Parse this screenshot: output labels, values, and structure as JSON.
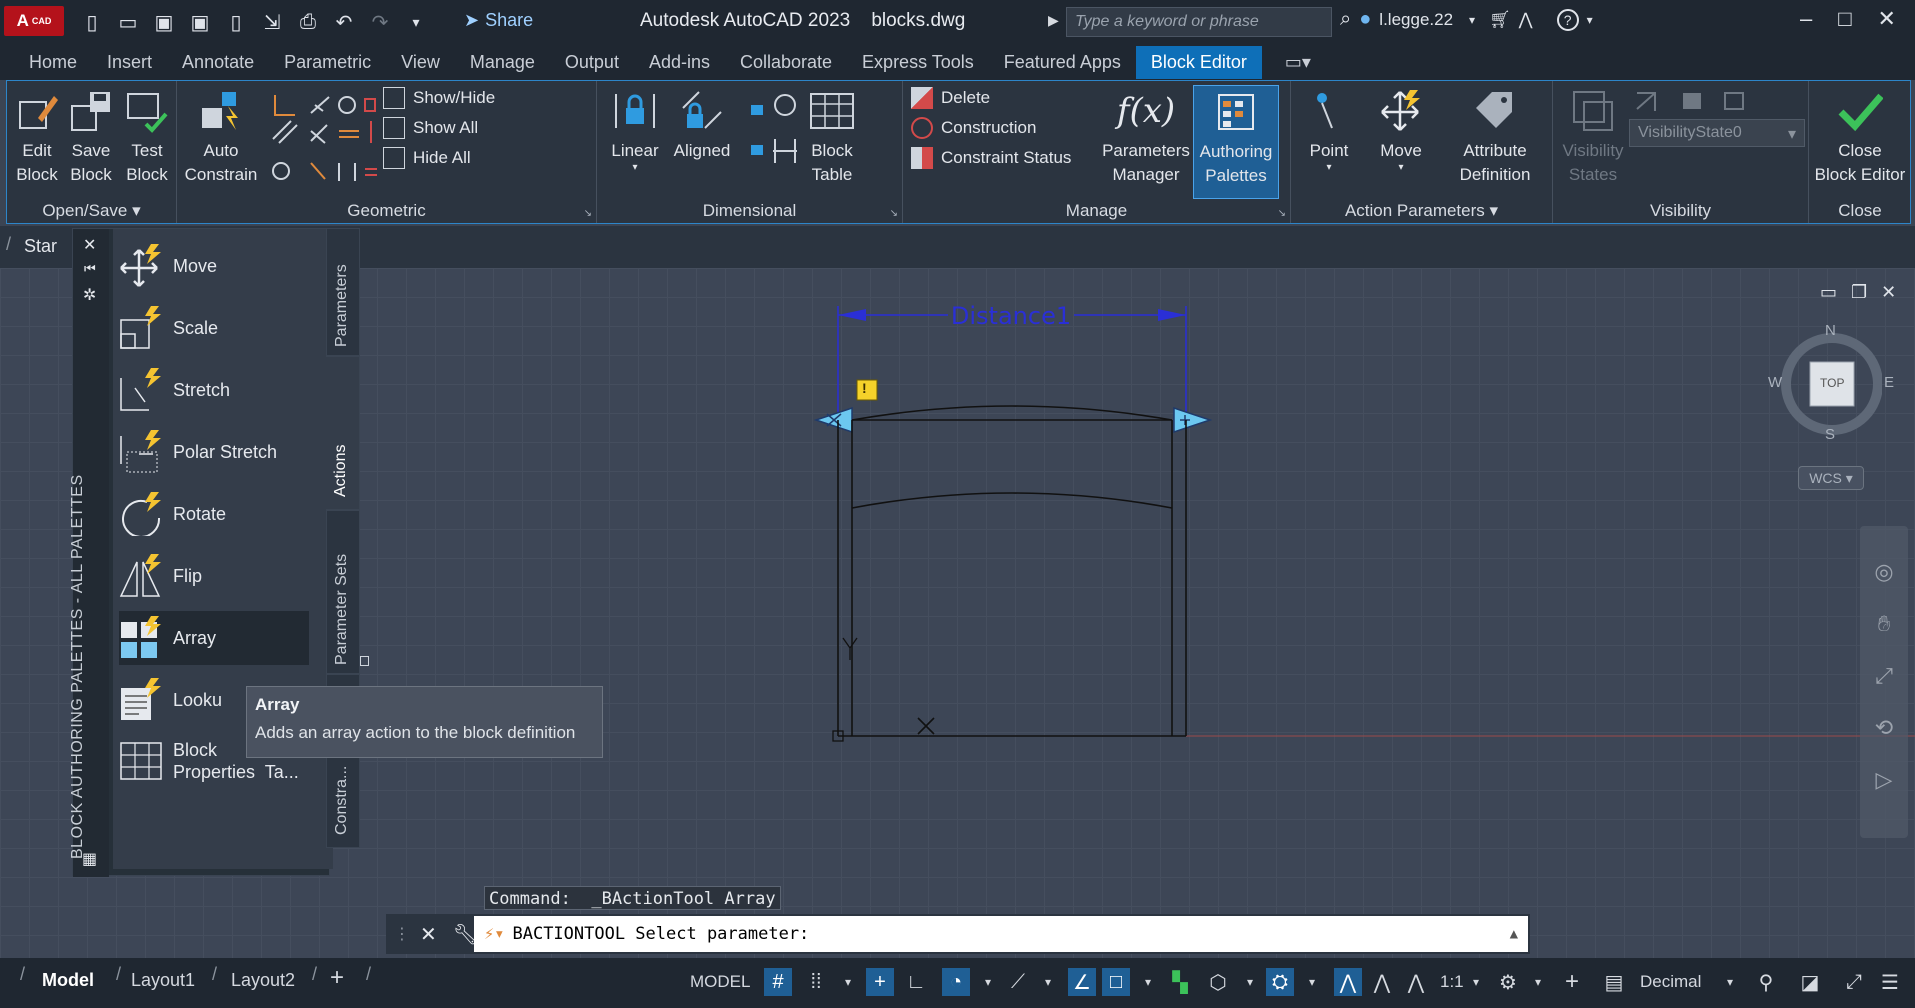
{
  "app": {
    "logo_text": "A",
    "logo_sub": "CAD",
    "share_label": "Share",
    "title": "Autodesk AutoCAD 2023",
    "file": "blocks.dwg",
    "search_placeholder": "Type a keyword or phrase",
    "user": "l.legge.22"
  },
  "tabs": [
    "Home",
    "Insert",
    "Annotate",
    "Parametric",
    "View",
    "Manage",
    "Output",
    "Add-ins",
    "Collaborate",
    "Express Tools",
    "Featured Apps",
    "Block Editor"
  ],
  "active_tab": "Block Editor",
  "ribbon": {
    "open_save": {
      "title": "Open/Save",
      "edit_block": "Edit\nBlock",
      "save_block": "Save\nBlock",
      "test_block": "Test\nBlock"
    },
    "geometric": {
      "title": "Geometric",
      "auto_constrain": "Auto\nConstrain",
      "show_hide": "Show/Hide",
      "show_all": "Show All",
      "hide_all": "Hide All"
    },
    "dimensional": {
      "title": "Dimensional",
      "linear": "Linear",
      "aligned": "Aligned",
      "block_table": "Block\nTable"
    },
    "manage": {
      "title": "Manage",
      "delete": "Delete",
      "construction": "Construction",
      "constraint_status": "Constraint Status",
      "parameters_manager": "Parameters\nManager",
      "authoring_palettes": "Authoring\nPalettes"
    },
    "action_parameters": {
      "title": "Action Parameters",
      "point": "Point",
      "move": "Move",
      "attribute_definition": "Attribute\nDefinition"
    },
    "visibility": {
      "title": "Visibility",
      "visibility_states": "Visibility\nStates",
      "state_value": "VisibilityState0"
    },
    "close": {
      "title": "Close",
      "close_block_editor": "Close\nBlock Editor"
    }
  },
  "file_tab": "Star",
  "palette": {
    "vertical_title": "BLOCK AUTHORING PALETTES - ALL PALETTES",
    "items": [
      "Move",
      "Scale",
      "Stretch",
      "Polar Stretch",
      "Rotate",
      "Flip",
      "Array",
      "Looku",
      "Block\nProperties  Ta..."
    ],
    "selected": "Array",
    "side_tabs": [
      "Parameters",
      "Actions",
      "Parameter Sets",
      "Constra..."
    ],
    "active_side_tab": "Actions"
  },
  "tooltip": {
    "title": "Array",
    "description": "Adds an array action to the block definition"
  },
  "drawing": {
    "dimension_label": "Distance1",
    "warning_glyph": "!"
  },
  "viewcube": {
    "n": "N",
    "s": "S",
    "e": "E",
    "w": "W",
    "face": "TOP",
    "wcs": "WCS"
  },
  "command": {
    "history": "Command:  _BActionTool Array",
    "prompt": "BACTIONTOOL Select parameter:"
  },
  "status": {
    "tabs": [
      "Model",
      "Layout1",
      "Layout2"
    ],
    "model_label": "MODEL",
    "scale": "1:1",
    "units": "Decimal"
  },
  "colors": {
    "accent": "#0e6fb8",
    "titlebar": "#1f2731",
    "ribbon": "#2b3440",
    "viewport": "#3d4656",
    "dimension": "#2a2fd6"
  }
}
